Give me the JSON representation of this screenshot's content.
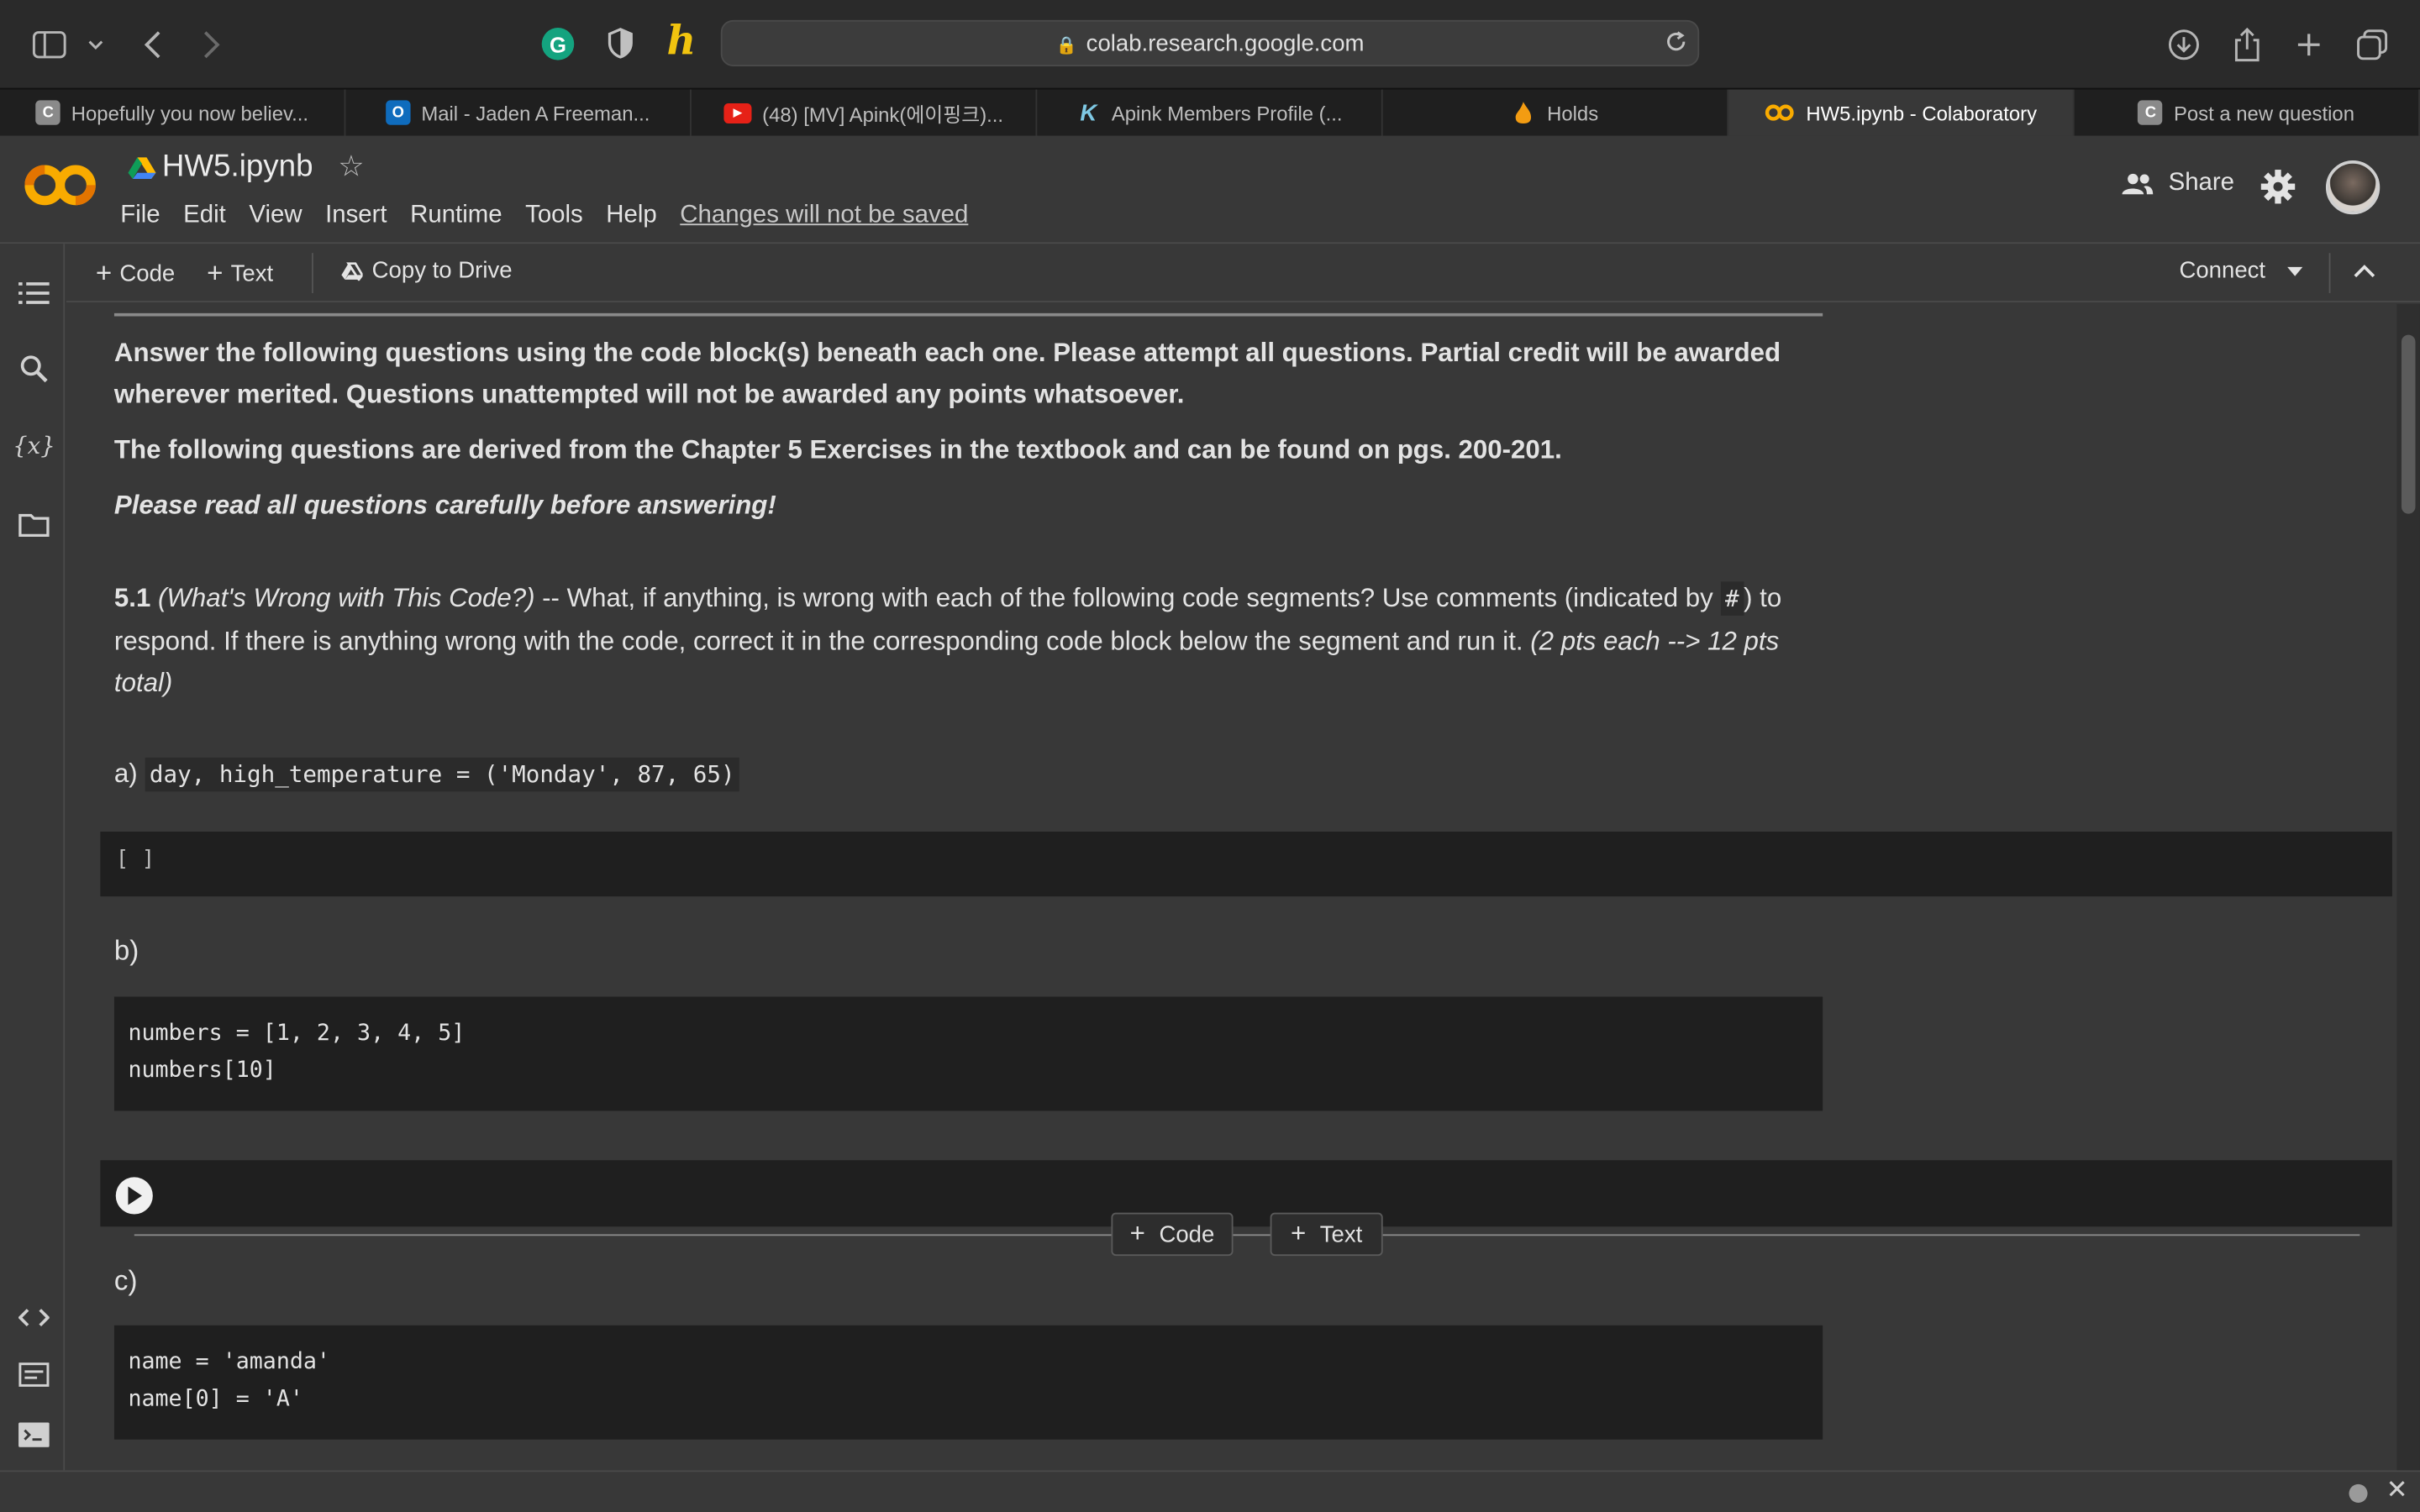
{
  "browser": {
    "address": "colab.research.google.com",
    "tabs": [
      {
        "label": "Hopefully you now believ...",
        "favicon": "C",
        "favicon_color": "#8a8a8a"
      },
      {
        "label": "Mail - Jaden A Freeman...",
        "favicon": "O",
        "favicon_color": "#0f6cbd"
      },
      {
        "label": "(48) [MV] Apink(에이핑크)...",
        "favicon": "▶",
        "favicon_color": "#e62117"
      },
      {
        "label": "Apink Members Profile (...",
        "favicon": "K",
        "favicon_color": "#1e1e1e"
      },
      {
        "label": "Holds",
        "favicon": "flame-icon",
        "favicon_color": "#f39c12"
      },
      {
        "label": "HW5.ipynb - Colaboratory",
        "favicon": "CO",
        "favicon_color": "#f9ab00",
        "active": true
      },
      {
        "label": "Post a new question",
        "favicon": "C",
        "favicon_color": "#8a8a8a"
      }
    ]
  },
  "colab": {
    "title": "HW5.ipynb",
    "menu": [
      "File",
      "Edit",
      "View",
      "Insert",
      "Runtime",
      "Tools",
      "Help"
    ],
    "unsaved": "Changes will not be saved",
    "share": "Share",
    "toolbar": {
      "code": "Code",
      "text": "Text",
      "copy": "Copy to Drive",
      "connect": "Connect"
    }
  },
  "notebook": {
    "intro1": "Answer the following questions using the code block(s) beneath each one. Please attempt all questions. Partial credit will be awarded wherever merited. Questions unattempted will not be awarded any points whatsoever.",
    "intro2": "The following questions are derived from the Chapter 5 Exercises in the textbook and can be found on pgs. 200-201.",
    "intro3": "Please read all questions carefully before answering!",
    "q_num": "5.1",
    "q_title": "(What's Wrong with This Code?)",
    "q_body1": " -- What, if anything, is wrong with each of the following code segments? Use comments (indicated by ",
    "q_hash": "#",
    "q_body2": ") to respond. If there is anything wrong with the code, correct it in the corresponding code block below the segment and run it. ",
    "q_pts": "(2 pts each --> 12 pts total)",
    "a_label": "a)",
    "a_code": "day, high_temperature = ('Monday', 87, 65)",
    "empty_bracket": "[ ]",
    "b_label": "b)",
    "b_code": [
      "numbers = [1, 2, 3, 4, 5]",
      "numbers[10]"
    ],
    "c_label": "c)",
    "c_code": [
      "name = 'amanda'",
      "name[0] = 'A'"
    ],
    "add_code": "Code",
    "add_text": "Text"
  }
}
